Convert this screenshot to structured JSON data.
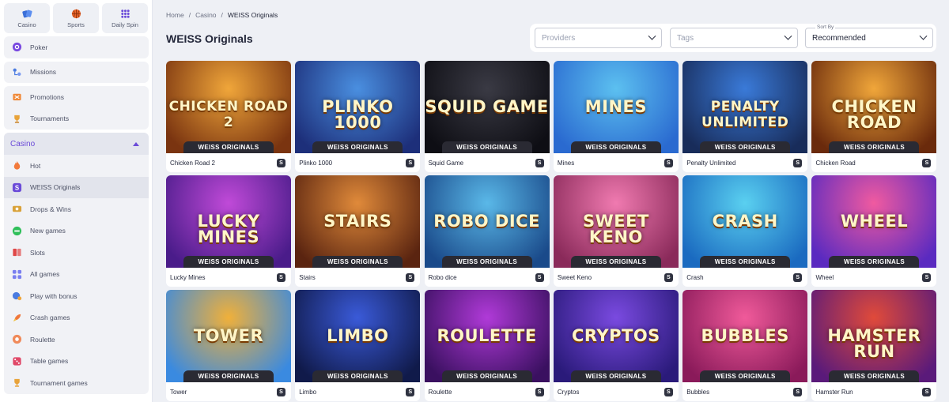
{
  "sidebar": {
    "tiles": [
      {
        "label": "Casino",
        "icon": "casino-cards-icon",
        "color": "#3b6fd8"
      },
      {
        "label": "Sports",
        "icon": "basketball-icon",
        "color": "#e8662c"
      },
      {
        "label": "Daily Spin",
        "icon": "dots-grid-icon",
        "color": "#6b4bd8"
      }
    ],
    "poker": {
      "label": "Poker",
      "icon": "poker-chip-icon"
    },
    "missions": {
      "label": "Missions",
      "icon": "missions-icon"
    },
    "promo": [
      {
        "label": "Promotions",
        "icon": "gift-icon"
      },
      {
        "label": "Tournaments",
        "icon": "trophy-icon"
      }
    ],
    "casino": {
      "label": "Casino",
      "items": [
        {
          "label": "Hot",
          "icon": "flame-icon",
          "color": "#f27a3c"
        },
        {
          "label": "WEISS Originals",
          "icon": "weiss-s-icon",
          "color": "#6b4bd8"
        },
        {
          "label": "Drops & Wins",
          "icon": "drops-wins-icon",
          "color": "#d9a23a"
        },
        {
          "label": "New games",
          "icon": "new-badge-icon",
          "color": "#2fbf5a"
        },
        {
          "label": "Slots",
          "icon": "slots-icon",
          "color": "#e04848"
        },
        {
          "label": "All games",
          "icon": "all-games-icon",
          "color": "#7a7ff0"
        },
        {
          "label": "Play with bonus",
          "icon": "bonus-icon",
          "color": "#4a7be0"
        },
        {
          "label": "Crash games",
          "icon": "rocket-icon",
          "color": "#f0783c"
        },
        {
          "label": "Roulette",
          "icon": "roulette-icon",
          "color": "#f08a5a"
        },
        {
          "label": "Table games",
          "icon": "dice-icon",
          "color": "#e04868"
        },
        {
          "label": "Tournament games",
          "icon": "trophy-icon",
          "color": "#e8a33a"
        }
      ]
    }
  },
  "breadcrumb": {
    "home": "Home",
    "sep": "/",
    "casino": "Casino",
    "current": "WEISS Originals"
  },
  "page_title": "WEISS Originals",
  "filters": {
    "providers_placeholder": "Providers",
    "tags_placeholder": "Tags",
    "sort_label": "Sort By",
    "sort_value": "Recommended"
  },
  "ribbon_text": "WEISS ORIGINALS",
  "badge_letter": "S",
  "games": [
    {
      "name": "Chicken Road 2",
      "logo": "CHICKEN ROAD 2",
      "bg1": "#f0a63a",
      "bg2": "#7a3410"
    },
    {
      "name": "Plinko 1000",
      "logo": "PLINKO 1000",
      "bg1": "#4a8fe0",
      "bg2": "#1d2f7a"
    },
    {
      "name": "Squid Game",
      "logo": "SQUID GAME",
      "bg1": "#3a3a44",
      "bg2": "#0e0e14"
    },
    {
      "name": "Mines",
      "logo": "MINES",
      "bg1": "#5cc0f0",
      "bg2": "#2a6ad0"
    },
    {
      "name": "Penalty Unlimited",
      "logo": "PENALTY UNLIMITED",
      "bg1": "#3a7ad8",
      "bg2": "#182c5a"
    },
    {
      "name": "Chicken Road",
      "logo": "CHICKEN ROAD",
      "bg1": "#f0a63a",
      "bg2": "#6a2a0c"
    },
    {
      "name": "Lucky Mines",
      "logo": "LUCKY MINES",
      "bg1": "#c04ad8",
      "bg2": "#4a1c8a"
    },
    {
      "name": "Stairs",
      "logo": "STAIRS",
      "bg1": "#e08a3a",
      "bg2": "#5a2410"
    },
    {
      "name": "Robo dice",
      "logo": "ROBO DICE",
      "bg1": "#5ab8e8",
      "bg2": "#1a4a8a"
    },
    {
      "name": "Sweet Keno",
      "logo": "SWEET KENO",
      "bg1": "#f07ab0",
      "bg2": "#8a2a5a"
    },
    {
      "name": "Crash",
      "logo": "CRASH",
      "bg1": "#5ad0f0",
      "bg2": "#1a6ac0"
    },
    {
      "name": "Wheel",
      "logo": "WHEEL",
      "bg1": "#f05aa0",
      "bg2": "#5a2ac0"
    },
    {
      "name": "Tower",
      "logo": "TOWER",
      "bg1": "#f0b03a",
      "bg2": "#3a8ae0"
    },
    {
      "name": "Limbo",
      "logo": "LIMBO",
      "bg1": "#3a5ad8",
      "bg2": "#101a4a"
    },
    {
      "name": "Roulette",
      "logo": "ROULETTE",
      "bg1": "#b03ad8",
      "bg2": "#3a1060"
    },
    {
      "name": "Cryptos",
      "logo": "CRYPTOS",
      "bg1": "#7a4ae0",
      "bg2": "#2a1a7a"
    },
    {
      "name": "Bubbles",
      "logo": "BUBBLES",
      "bg1": "#f05a9a",
      "bg2": "#8a1a5a"
    },
    {
      "name": "Hamster Run",
      "logo": "HAMSTER RUN",
      "bg1": "#e04a3a",
      "bg2": "#5a1a7a"
    }
  ]
}
